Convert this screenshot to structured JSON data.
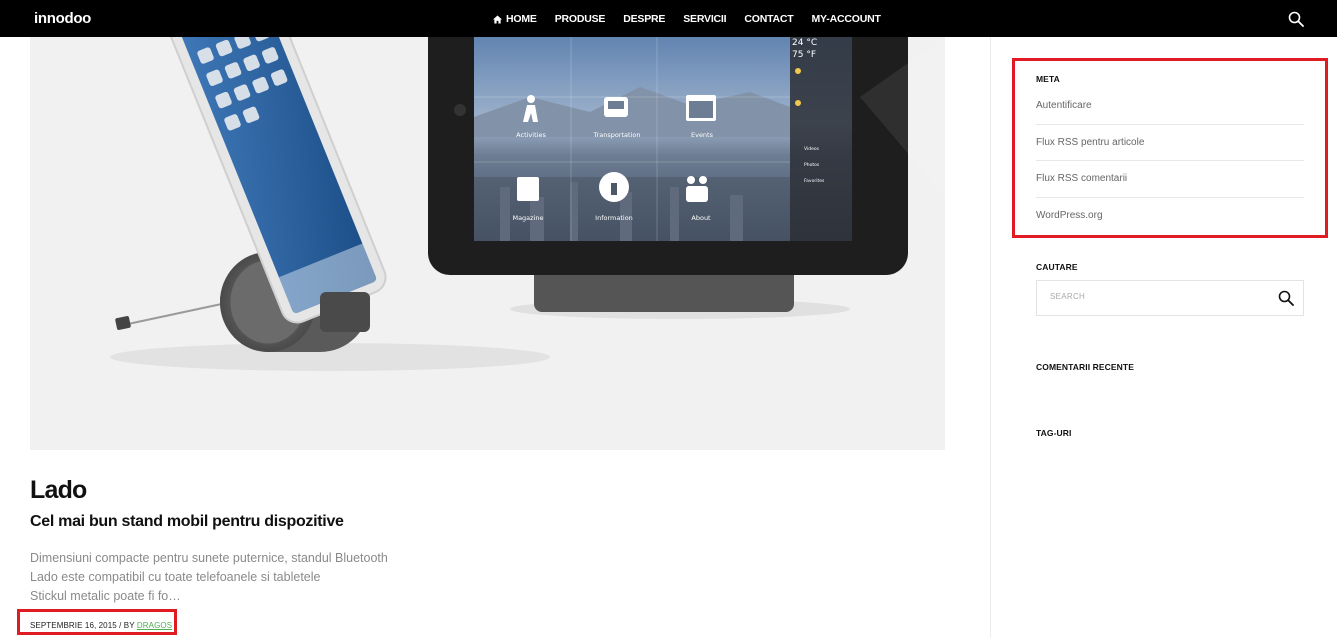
{
  "header": {
    "logo": "innodoo",
    "nav": [
      {
        "label": "HOME",
        "icon": "home-icon"
      },
      {
        "label": "PRODUSE"
      },
      {
        "label": "DESPRE"
      },
      {
        "label": "SERVICII"
      },
      {
        "label": "CONTACT"
      },
      {
        "label": "MY-ACCOUNT"
      }
    ],
    "search_icon": "search-icon"
  },
  "hero": {
    "tiles": [
      "Activities",
      "Transportation",
      "Events",
      "Magazine",
      "Information",
      "About"
    ],
    "weather": [
      "24 °C",
      "75 °F"
    ],
    "side_menu": [
      "Videos",
      "Photos",
      "Favorites"
    ]
  },
  "post": {
    "title": "Lado",
    "subtitle": "Cel mai bun stand mobil pentru dispozitive",
    "excerpt_lines": [
      "Dimensiuni compacte pentru sunete puternice, standul Bluetooth",
      "Lado este compatibil cu toate telefoanele si tabletele",
      "Stickul metalic poate fi fo…"
    ],
    "date": "SEPTEMBRIE 16, 2015",
    "by": " / BY ",
    "author": "DRAGOS"
  },
  "sidebar": {
    "meta_title": "META",
    "meta_links": [
      "Autentificare",
      "Flux RSS pentru articole",
      "Flux RSS comentarii",
      "WordPress.org"
    ],
    "search_title": "CAUTARE",
    "search_placeholder": "SEARCH",
    "recent_comments_title": "COMENTARII RECENTE",
    "tags_title": "TAG-URI"
  },
  "colors": {
    "topbar": "#000000",
    "highlight": "#e01b24",
    "author_link": "#4caf50"
  }
}
